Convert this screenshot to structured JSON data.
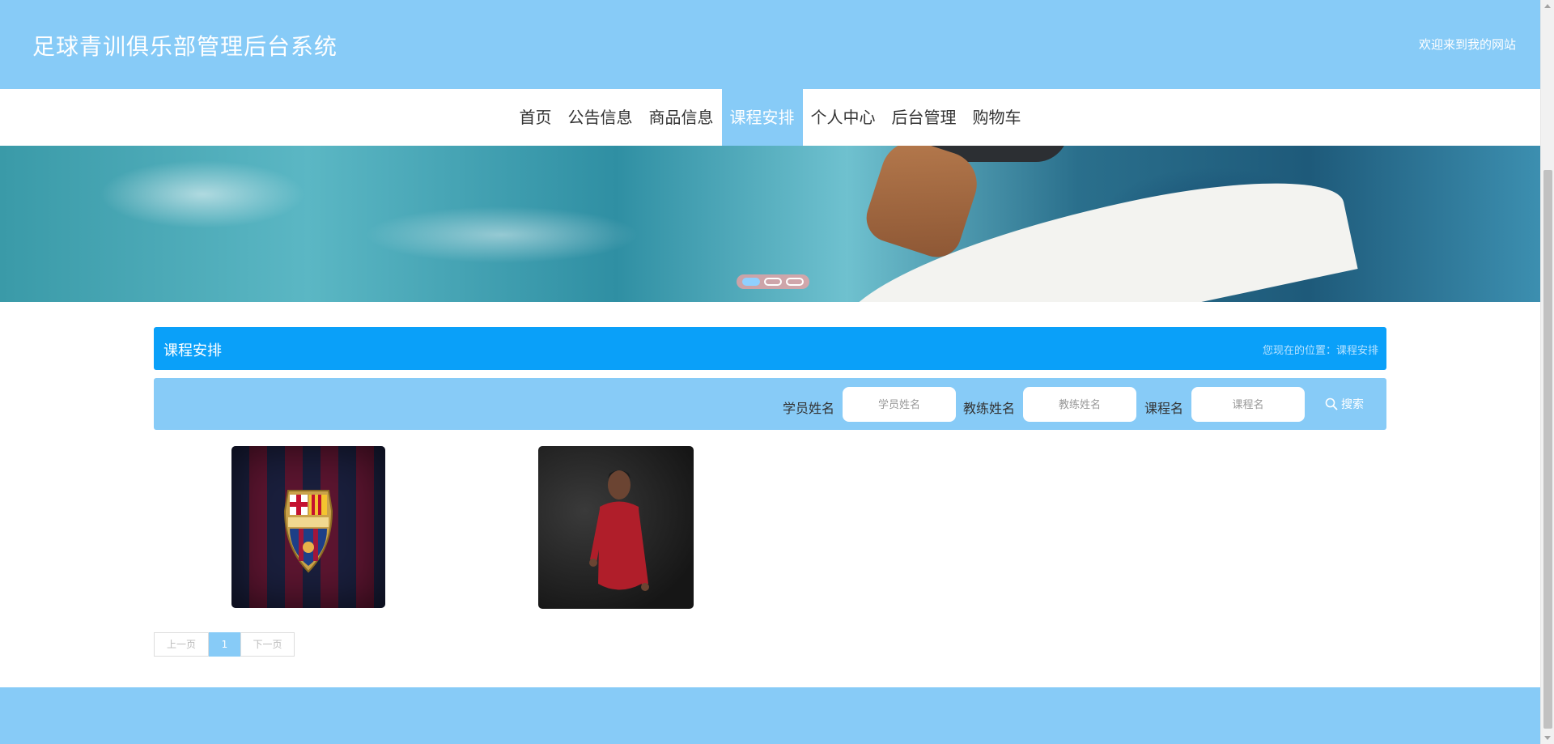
{
  "header": {
    "title": "足球青训俱乐部管理后台系统",
    "welcome": "欢迎来到我的网站"
  },
  "nav": {
    "items": [
      {
        "label": "首页",
        "active": false
      },
      {
        "label": "公告信息",
        "active": false
      },
      {
        "label": "商品信息",
        "active": false
      },
      {
        "label": "课程安排",
        "active": true
      },
      {
        "label": "个人中心",
        "active": false
      },
      {
        "label": "后台管理",
        "active": false
      },
      {
        "label": "购物车",
        "active": false
      }
    ]
  },
  "banner": {
    "slides": 3,
    "active_slide": 1
  },
  "section": {
    "title": "课程安排",
    "breadcrumb": "您现在的位置：课程安排"
  },
  "search": {
    "student_label": "学员姓名",
    "student_placeholder": "学员姓名",
    "coach_label": "教练姓名",
    "coach_placeholder": "教练姓名",
    "course_label": "课程名",
    "course_placeholder": "课程名",
    "button_label": "搜索"
  },
  "cards": [
    {
      "image": "fc-barcelona-crest"
    },
    {
      "image": "soccer-player-red-jersey"
    }
  ],
  "pagination": {
    "prev": "上一页",
    "current": "1",
    "next": "下一页"
  },
  "colors": {
    "header_bg": "#87cbf7",
    "title_bar_bg": "#0aa0f9",
    "active_nav_bg": "#87cbf7"
  }
}
